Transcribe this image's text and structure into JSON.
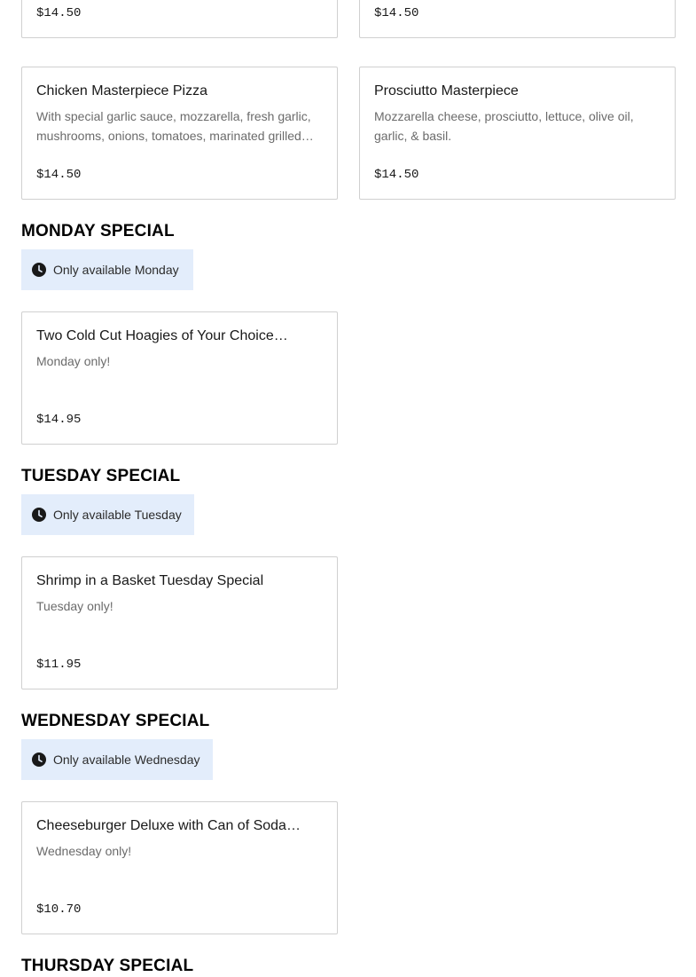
{
  "top_row": [
    {
      "price": "$14.50"
    },
    {
      "price": "$14.50"
    }
  ],
  "items_row2": [
    {
      "title": "Chicken Masterpiece Pizza",
      "description": "With special garlic sauce, mozzarella, fresh garlic, mushrooms, onions, tomatoes, marinated grilled…",
      "price": "$14.50"
    },
    {
      "title": "Prosciutto Masterpiece",
      "description": "Mozzarella cheese, prosciutto, lettuce, olive oil, garlic, & basil.",
      "price": "$14.50"
    }
  ],
  "sections": [
    {
      "heading": "MONDAY SPECIAL",
      "availability": "Only available Monday",
      "item": {
        "title": "Two Cold Cut Hoagies of Your Choice…",
        "description": "Monday only!",
        "price": "$14.95"
      }
    },
    {
      "heading": "TUESDAY SPECIAL",
      "availability": "Only available Tuesday",
      "item": {
        "title": "Shrimp in a Basket Tuesday Special",
        "description": "Tuesday only!",
        "price": "$11.95"
      }
    },
    {
      "heading": "WEDNESDAY SPECIAL",
      "availability": "Only available Wednesday",
      "item": {
        "title": "Cheeseburger Deluxe with Can of Soda…",
        "description": "Wednesday only!",
        "price": "$10.70"
      }
    },
    {
      "heading": "THURSDAY SPECIAL"
    }
  ],
  "icons": {
    "availability": "clock-icon"
  }
}
